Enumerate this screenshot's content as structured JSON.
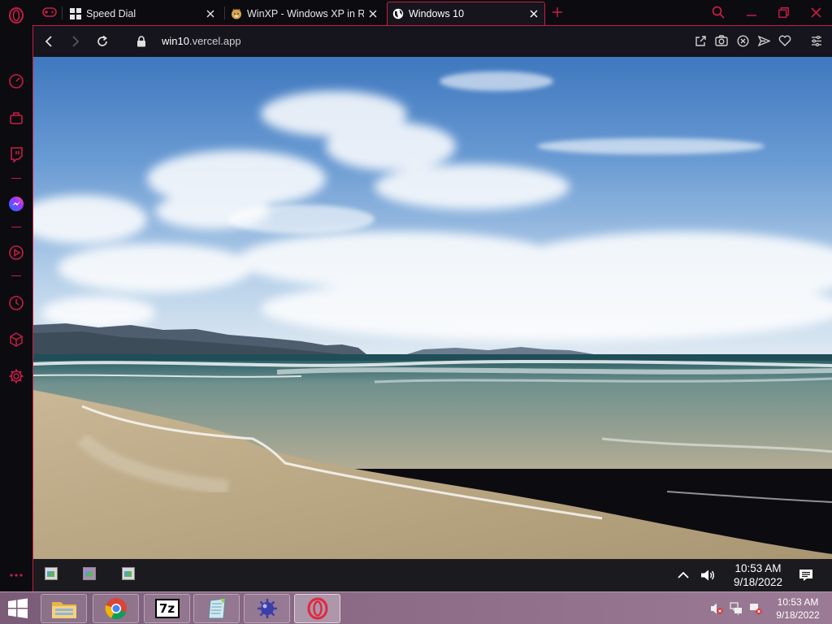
{
  "browser": {
    "tabs": [
      {
        "title": "Speed Dial",
        "icon": "grid-icon"
      },
      {
        "title": "WinXP - Windows XP in Re",
        "icon": "doge-icon"
      },
      {
        "title": "Windows 10",
        "icon": "globe-icon"
      }
    ],
    "url": {
      "host": "win10",
      "domain": ".vercel.app"
    },
    "accent": "#c41f45"
  },
  "win10": {
    "clock": {
      "time": "10:53 AM",
      "date": "9/18/2022"
    }
  },
  "host": {
    "clock": {
      "time": "10:53 AM",
      "date": "9/18/2022"
    },
    "apps": [
      "file-explorer-icon",
      "chrome-icon",
      "7zip-icon",
      "notepad-icon",
      "mine-icon",
      "opera-icon"
    ],
    "seven_zip_label": "7z"
  }
}
